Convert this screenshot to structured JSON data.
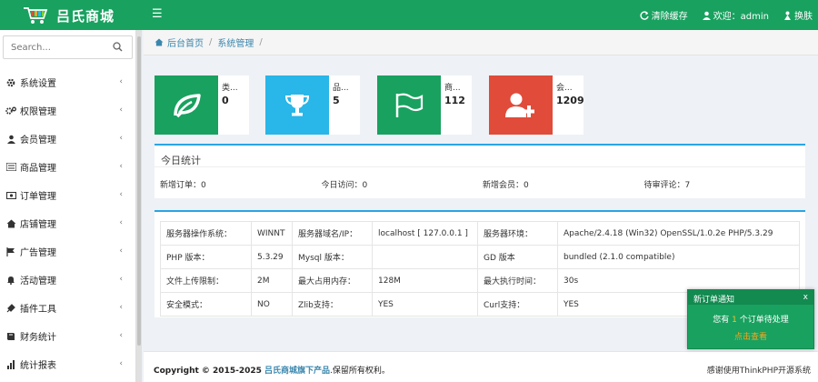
{
  "header": {
    "logo_text": "吕氏商城",
    "clear_cache": "清除缓存",
    "welcome": "欢迎：admin",
    "change_skin": "换肤"
  },
  "sidebar": {
    "search_placeholder": "Search...",
    "items": [
      {
        "label": "系统设置",
        "icon": "gear-icon"
      },
      {
        "label": "权限管理",
        "icon": "gears-icon"
      },
      {
        "label": "会员管理",
        "icon": "user-icon"
      },
      {
        "label": "商品管理",
        "icon": "list-icon"
      },
      {
        "label": "订单管理",
        "icon": "money-icon"
      },
      {
        "label": "店铺管理",
        "icon": "home-icon"
      },
      {
        "label": "广告管理",
        "icon": "flag-icon"
      },
      {
        "label": "活动管理",
        "icon": "bell-icon"
      },
      {
        "label": "插件工具",
        "icon": "plug-icon"
      },
      {
        "label": "财务统计",
        "icon": "book-icon"
      },
      {
        "label": "统计报表",
        "icon": "bar-chart-icon"
      }
    ]
  },
  "breadcrumb": {
    "home": "后台首页",
    "sep1": "/",
    "current": "系统管理",
    "sep2": "/"
  },
  "cards": [
    {
      "label": "类...",
      "value": "0",
      "icon": "leaf-icon",
      "color": "#19a15f"
    },
    {
      "label": "品...",
      "value": "5",
      "icon": "trophy-icon",
      "color": "#29b6e8"
    },
    {
      "label": "商...",
      "value": "112",
      "icon": "flag-icon",
      "color": "#19a15f"
    },
    {
      "label": "会...",
      "value": "1209",
      "icon": "user-plus-icon",
      "color": "#e04b3a"
    }
  ],
  "today": {
    "title": "今日统计",
    "stats": [
      "新增订单：0",
      "今日访问：0",
      "新增会员：0",
      "待审评论：7"
    ]
  },
  "sysinfo": {
    "rows": [
      [
        "服务器操作系统：",
        "WINNT",
        "服务器域名/IP：",
        "localhost [ 127.0.0.1 ]",
        "服务器环境：",
        "Apache/2.4.18 (Win32) OpenSSL/1.0.2e PHP/5.3.29"
      ],
      [
        "PHP 版本：",
        "5.3.29",
        "Mysql 版本：",
        "",
        "GD 版本",
        "bundled (2.1.0 compatible)"
      ],
      [
        "文件上传限制：",
        "2M",
        "最大占用内存：",
        "128M",
        "最大执行时间：",
        "30s"
      ],
      [
        "安全模式：",
        "NO",
        "Zlib支持：",
        "YES",
        "Curl支持：",
        "YES"
      ]
    ]
  },
  "footer": {
    "copyright": "Copyright © 2015-2025",
    "company_link": "吕氏商城旗下产品",
    "rights": ".保留所有权利。",
    "right_text": "感谢使用ThinkPHP开源系统"
  },
  "notice": {
    "title": "新订单通知",
    "close": "x",
    "msg_prefix": "您有",
    "msg_count": "1",
    "msg_suffix": "个订单待处理",
    "link": "点击查看"
  },
  "colors": {
    "brand": "#19a15f",
    "accent_blue": "#29a5e6",
    "link": "#3a87ad"
  }
}
